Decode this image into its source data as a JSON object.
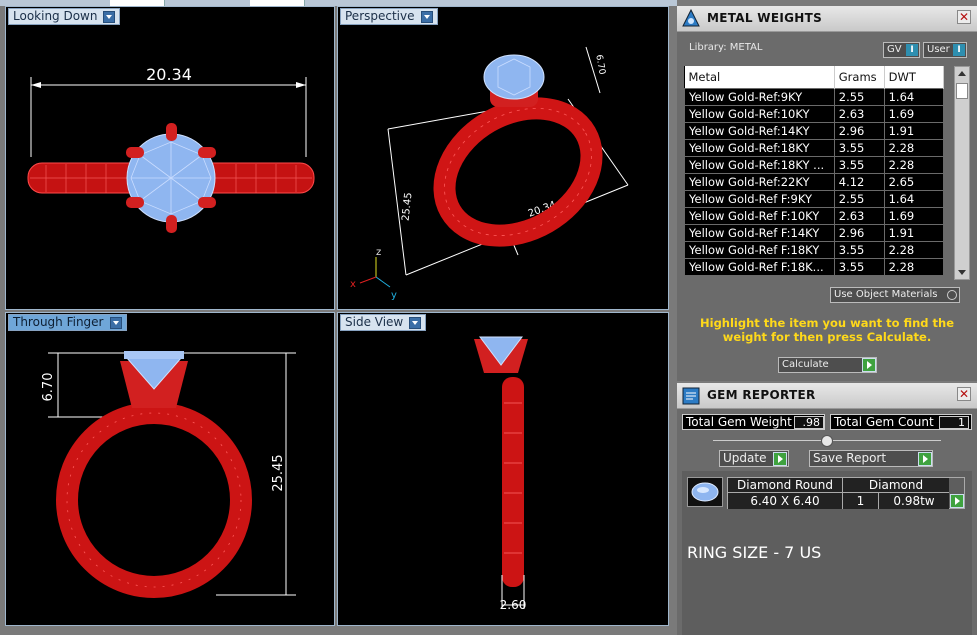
{
  "viewports": {
    "top_left": {
      "label": "Looking Down",
      "dimension": "20.34"
    },
    "top_right": {
      "label": "Perspective",
      "dim_head": "6.70",
      "dim_height": "25.45",
      "dim_width": "20.34",
      "axis_z": "z",
      "axis_x": "x",
      "axis_y": "y"
    },
    "bottom_left": {
      "label": "Through Finger",
      "dim_head": "6.70",
      "dim_height": "25.45"
    },
    "bottom_right": {
      "label": "Side View",
      "dim_band": "2.60"
    }
  },
  "metal_weights": {
    "title": "METAL WEIGHTS",
    "library_label": "Library: METAL",
    "gv_label": "GV",
    "user_label": "User",
    "columns": [
      "Metal",
      "Grams",
      "DWT"
    ],
    "rows": [
      [
        "Yellow Gold-Ref:9KY",
        "2.55",
        "1.64"
      ],
      [
        "Yellow Gold-Ref:10KY",
        "2.63",
        "1.69"
      ],
      [
        "Yellow Gold-Ref:14KY",
        "2.96",
        "1.91"
      ],
      [
        "Yellow Gold-Ref:18KY",
        "3.55",
        "2.28"
      ],
      [
        "Yellow Gold-Ref:18KY ...",
        "3.55",
        "2.28"
      ],
      [
        "Yellow Gold-Ref:22KY",
        "4.12",
        "2.65"
      ],
      [
        "Yellow Gold-Ref F:9KY",
        "2.55",
        "1.64"
      ],
      [
        "Yellow Gold-Ref F:10KY",
        "2.63",
        "1.69"
      ],
      [
        "Yellow Gold-Ref F:14KY",
        "2.96",
        "1.91"
      ],
      [
        "Yellow Gold-Ref F:18KY",
        "3.55",
        "2.28"
      ],
      [
        "Yellow Gold-Ref F:18K...",
        "3.55",
        "2.28"
      ]
    ],
    "use_object_materials": "Use Object Materials",
    "hint": "Highlight the item you want to find the weight for then press Calculate.",
    "calculate_label": "Calculate"
  },
  "gem_reporter": {
    "title": "GEM REPORTER",
    "total_weight_label": "Total Gem Weight",
    "total_weight_value": ".98",
    "total_count_label": "Total Gem Count",
    "total_count_value": "1",
    "update_label": "Update",
    "save_report_label": "Save Report",
    "gem": {
      "name": "Diamond Round",
      "size": "6.40 X 6.40",
      "material": "Diamond",
      "count": "1",
      "weight": "0.98tw"
    },
    "ring_size": "RING SIZE - 7 US"
  },
  "colors": {
    "metal_red": "#e01414",
    "gem_blue": "#8fb6f0",
    "hint_yellow": "#ffd91a",
    "viewport_active": "#6fa6d8"
  }
}
